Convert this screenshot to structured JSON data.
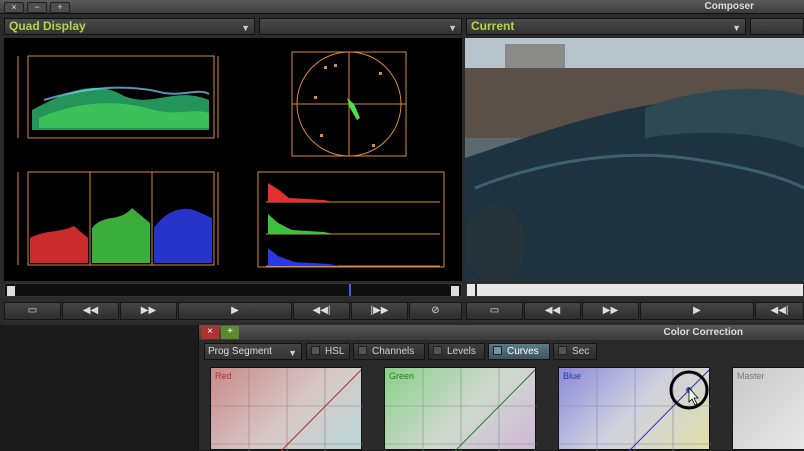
{
  "composer": {
    "title": "Composer",
    "window_buttons": [
      "×",
      "−",
      "+"
    ],
    "left_menu": {
      "selected": "Quad Display"
    },
    "mid_menu": {
      "selected": ""
    },
    "right_menu": {
      "selected": "Current"
    },
    "transport_left": [
      "layout-icon",
      "rewind-icon",
      "fast-forward-icon",
      "play-icon",
      "step-back-icon",
      "step-forward-icon",
      "disable-icon"
    ],
    "transport_right": [
      "layout-icon",
      "rewind-icon",
      "fast-forward-icon",
      "play-icon",
      "step-back-icon"
    ]
  },
  "color_correction": {
    "title": "Color Correction",
    "close_label": "×",
    "add_label": "+",
    "segment": "Prog Segment",
    "tabs": [
      {
        "label": "HSL",
        "active": false
      },
      {
        "label": "Channels",
        "active": false
      },
      {
        "label": "Levels",
        "active": false
      },
      {
        "label": "Curves",
        "active": true
      },
      {
        "label": "Sec",
        "active": false
      }
    ],
    "curves": [
      {
        "label": "Red",
        "color": "#e07a7a"
      },
      {
        "label": "Green",
        "color": "#7ad07a"
      },
      {
        "label": "Blue",
        "color": "#7a7ae0"
      },
      {
        "label": "Master",
        "color": "#bbbbbb"
      }
    ]
  },
  "colors": {
    "accent": "#b7d34a",
    "scope_orange": "#d98a3a",
    "active_tab": "#4f6b7a"
  }
}
